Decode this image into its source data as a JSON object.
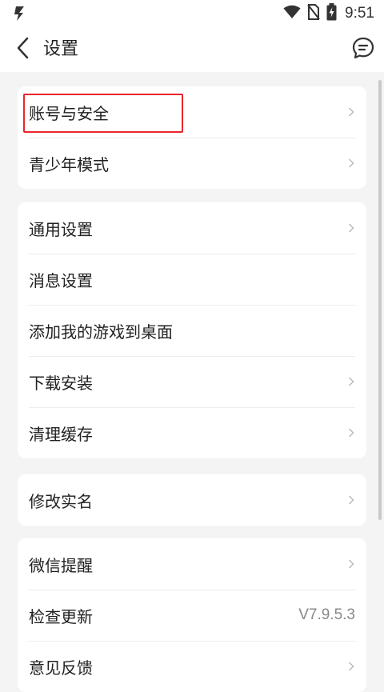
{
  "status_bar": {
    "time": "9:51",
    "app_icon": "app-logo-icon",
    "icons": [
      "wifi-icon",
      "no-sim-icon",
      "battery-charging-icon"
    ]
  },
  "header": {
    "title": "设置",
    "back_icon": "back-arrow-icon",
    "chat_icon": "chat-bubble-icon"
  },
  "groups": [
    {
      "items": [
        {
          "label": "账号与安全",
          "chevron": true
        },
        {
          "label": "青少年模式",
          "chevron": true
        }
      ]
    },
    {
      "items": [
        {
          "label": "通用设置",
          "chevron": true
        },
        {
          "label": "消息设置",
          "chevron": false
        },
        {
          "label": "添加我的游戏到桌面",
          "chevron": false
        },
        {
          "label": "下载安装",
          "chevron": true
        },
        {
          "label": "清理缓存",
          "chevron": true
        }
      ]
    },
    {
      "items": [
        {
          "label": "修改实名",
          "chevron": true
        }
      ]
    },
    {
      "items": [
        {
          "label": "微信提醒",
          "chevron": true
        },
        {
          "label": "检查更新",
          "value": "V7.9.5.3"
        },
        {
          "label": "意见反馈",
          "chevron": true
        }
      ]
    }
  ],
  "colors": {
    "background": "#f4f4f4",
    "card": "#ffffff",
    "highlight": "#e8262a",
    "text": "#222222",
    "muted": "#888888"
  }
}
